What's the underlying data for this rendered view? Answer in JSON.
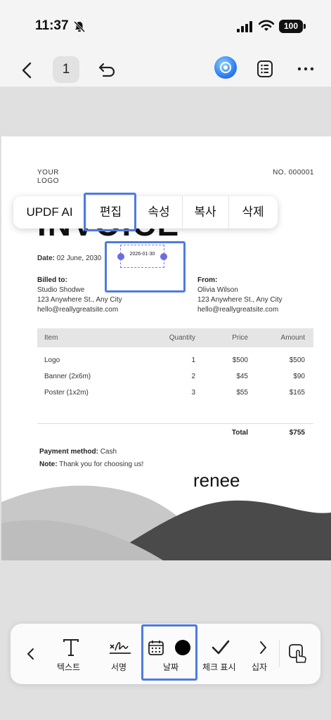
{
  "status_bar": {
    "time": "11:37",
    "battery": "100"
  },
  "top_nav": {
    "page_number": "1"
  },
  "document": {
    "logo_text": "YOUR\nLOGO",
    "number": "NO. 000001",
    "title": "INVOICE",
    "date_label": "Date:",
    "date_value": "02 June, 2030",
    "billed_to": {
      "label": "Billed to:",
      "name": "Studio Shodwe",
      "address": "123 Anywhere St., Any City",
      "email": "hello@reallygreatsite.com"
    },
    "from": {
      "label": "From:",
      "name": "Olivia Wilson",
      "address": "123 Anywhere St., Any City",
      "email": "hello@reallygreatsite.com"
    },
    "table": {
      "headers": [
        "Item",
        "Quantity",
        "Price",
        "Amount"
      ],
      "rows": [
        [
          "Logo",
          "1",
          "$500",
          "$500"
        ],
        [
          "Banner (2x6m)",
          "2",
          "$45",
          "$90"
        ],
        [
          "Poster (1x2m)",
          "3",
          "$55",
          "$165"
        ]
      ],
      "total_label": "Total",
      "total_value": "$755"
    },
    "payment_label": "Payment method:",
    "payment_value": "Cash",
    "note_label": "Note:",
    "note_value": "Thank you for choosing us!",
    "signature": "renee"
  },
  "date_annotation": {
    "text": "2026-01-30"
  },
  "context_menu": {
    "items": [
      "UPDF AI",
      "편집",
      "속성",
      "복사",
      "삭제"
    ]
  },
  "toolbar": {
    "items": [
      {
        "label": "텍스트",
        "icon": "text-icon"
      },
      {
        "label": "서명",
        "icon": "signature-icon"
      },
      {
        "label": "날짜",
        "icon": "calendar-icon"
      },
      {
        "label": "체크 표시",
        "icon": "check-icon"
      },
      {
        "label": "십자",
        "icon": "cross-icon"
      }
    ]
  }
}
